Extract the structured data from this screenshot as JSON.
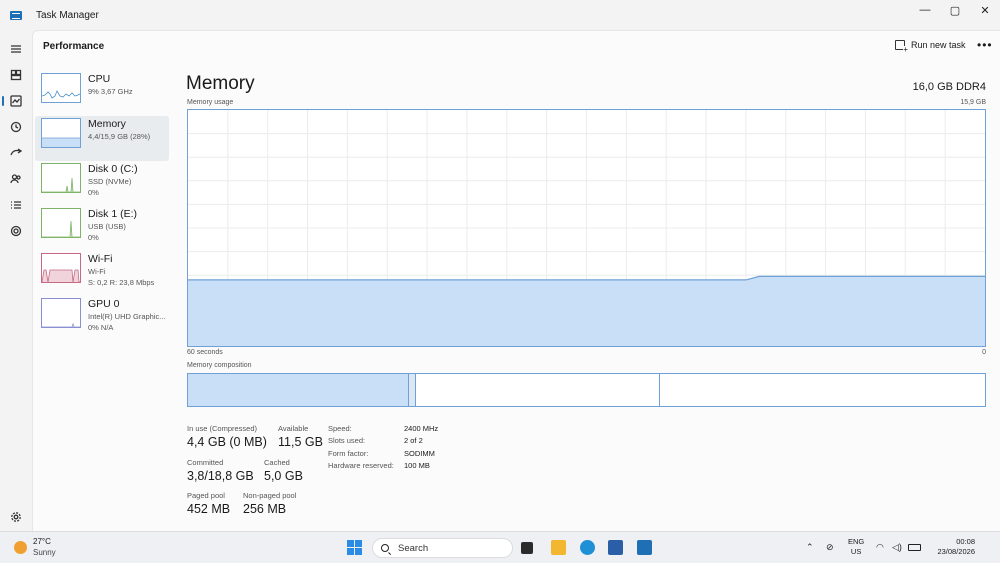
{
  "app": {
    "title": "Task Manager"
  },
  "window_controls": {
    "minimize": "—",
    "maximize": "▢",
    "close": "✕"
  },
  "nav": {
    "items": [
      {
        "name": "hamburger-menu-icon",
        "label": "Menu"
      },
      {
        "name": "processes-icon",
        "label": "Processes"
      },
      {
        "name": "performance-icon",
        "label": "Performance"
      },
      {
        "name": "app-history-icon",
        "label": "App history"
      },
      {
        "name": "startup-apps-icon",
        "label": "Startup apps"
      },
      {
        "name": "users-icon",
        "label": "Users"
      },
      {
        "name": "details-icon",
        "label": "Details"
      },
      {
        "name": "services-icon",
        "label": "Services"
      }
    ],
    "settings_icon": "gear-icon"
  },
  "header": {
    "title": "Performance",
    "run_task": "Run new task",
    "more": "•••"
  },
  "devices": [
    {
      "name": "CPU",
      "line1": "9%  3,67 GHz",
      "line2": ""
    },
    {
      "name": "Memory",
      "line1": "4,4/15,9 GB (28%)",
      "line2": ""
    },
    {
      "name": "Disk 0 (C:)",
      "line1": "SSD (NVMe)",
      "line2": "0%"
    },
    {
      "name": "Disk 1 (E:)",
      "line1": "USB (USB)",
      "line2": "0%"
    },
    {
      "name": "Wi-Fi",
      "line1": "Wi-Fi",
      "line2": "S: 0,2  R: 23,8 Mbps"
    },
    {
      "name": "GPU 0",
      "line1": "Intel(R) UHD Graphic...",
      "line2": "0%  N/A"
    }
  ],
  "memory": {
    "title": "Memory",
    "spec": "16,0 GB DDR4",
    "usage_label": "Memory usage",
    "usage_max": "15,9 GB",
    "time_left": "60 seconds",
    "time_right": "0",
    "composition_label": "Memory composition",
    "usage_series_pct": [
      28,
      28,
      28,
      28,
      28,
      28,
      28,
      28,
      28,
      28,
      28,
      28,
      28,
      28,
      28,
      28,
      28,
      28,
      28,
      28,
      28,
      28,
      28,
      28,
      28,
      28,
      28,
      28,
      28,
      28,
      28,
      28,
      28,
      28,
      28,
      28,
      28,
      28,
      28,
      28,
      28,
      28,
      28,
      29.5,
      29.5,
      29.5,
      29.5,
      29.5,
      29.5,
      29.5,
      29.5,
      29.5,
      29.5,
      29.5,
      29.5,
      29.5,
      29.5,
      29.5,
      29.5,
      29.5,
      29.5
    ]
  },
  "stats": {
    "in_use_label": "In use (Compressed)",
    "in_use_value": "4,4 GB (0 MB)",
    "available_label": "Available",
    "available_value": "11,5 GB",
    "committed_label": "Committed",
    "committed_value": "3,8/18,8 GB",
    "cached_label": "Cached",
    "cached_value": "5,0 GB",
    "paged_label": "Paged pool",
    "paged_value": "452 MB",
    "nonpaged_label": "Non-paged pool",
    "nonpaged_value": "256 MB"
  },
  "specs": [
    {
      "label": "Speed:",
      "value": "2400 MHz"
    },
    {
      "label": "Slots used:",
      "value": "2 of 2"
    },
    {
      "label": "Form factor:",
      "value": "SODIMM"
    },
    {
      "label": "Hardware reserved:",
      "value": "100 MB"
    }
  ],
  "taskbar": {
    "weather_temp": "27°C",
    "weather_desc": "Sunny",
    "search_placeholder": "Search",
    "lang_top": "ENG",
    "lang_bottom": "US",
    "time": "00:08",
    "date": "23/08/2026",
    "colors": {
      "accent": "#1f6fb5",
      "graph_fill": "#c9dff7",
      "graph_line": "#6fa0d6"
    }
  }
}
